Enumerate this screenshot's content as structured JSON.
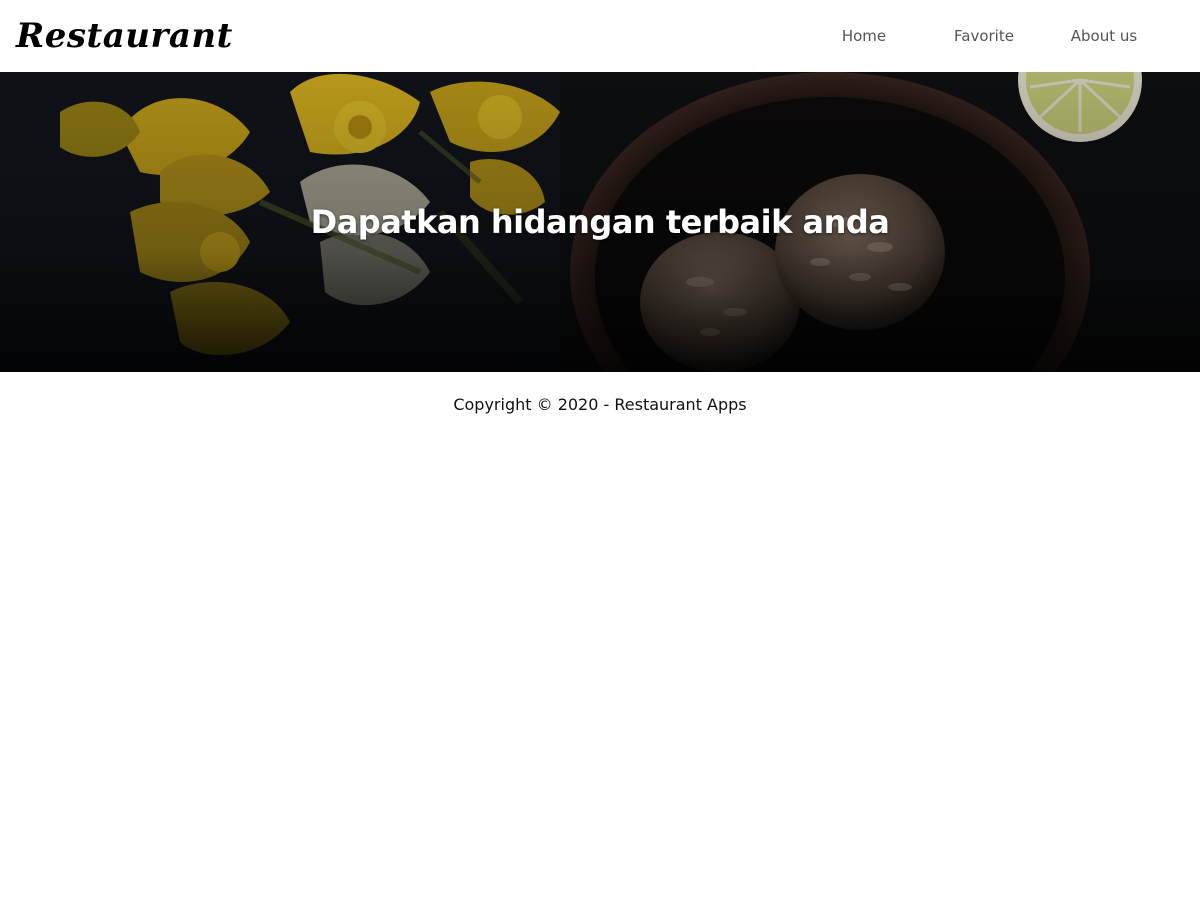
{
  "header": {
    "brand": "Restaurant",
    "nav": [
      {
        "label": "Home"
      },
      {
        "label": "Favorite"
      },
      {
        "label": "About us"
      }
    ]
  },
  "hero": {
    "title": "Dapatkan hidangan terbaik anda"
  },
  "footer": {
    "text": "Copyright © 2020 - Restaurant Apps"
  },
  "colors": {
    "background": "#ffffff",
    "nav_text": "#555555",
    "hero_overlay": "#0b0b0c",
    "hero_text": "#ffffff",
    "footer_text": "#111111"
  }
}
